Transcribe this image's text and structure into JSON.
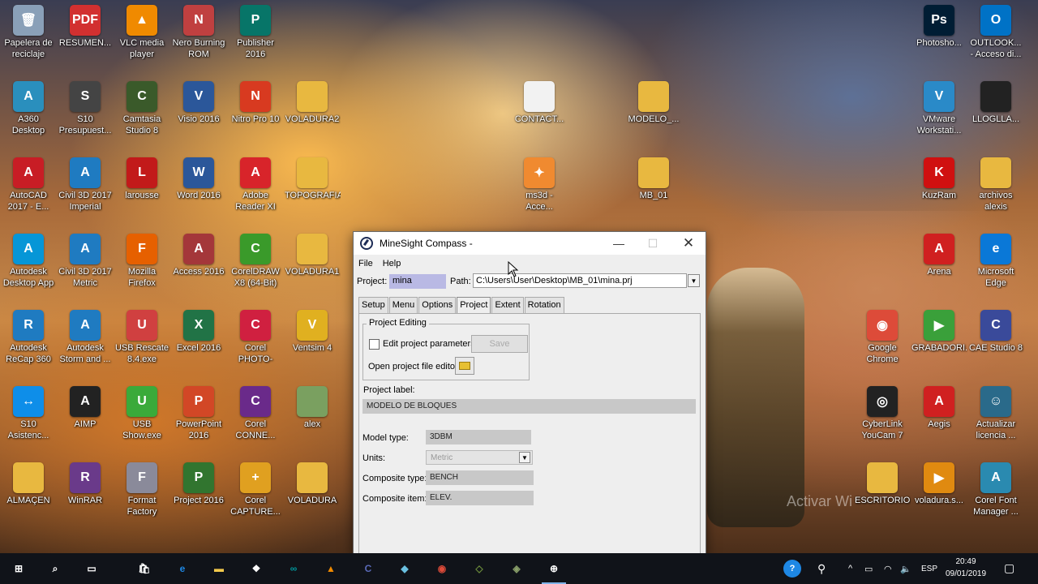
{
  "desktop": {
    "icons": [
      {
        "label": "Papelera de reciclaje",
        "icon": "recycle-bin-icon",
        "color": "#8aa0b8",
        "glyph": "🗑"
      },
      {
        "label": "RESUMEN...",
        "icon": "pdf-icon",
        "color": "#d23030",
        "glyph": "PDF"
      },
      {
        "label": "VLC media player",
        "icon": "vlc-icon",
        "color": "#f08a00",
        "glyph": "▲"
      },
      {
        "label": "Nero Burning ROM",
        "icon": "nero-icon",
        "color": "#c04040",
        "glyph": "N"
      },
      {
        "label": "Publisher 2016",
        "icon": "publisher-icon",
        "color": "#077568",
        "glyph": "P"
      },
      {
        "label": "A360 Desktop",
        "icon": "a360-icon",
        "color": "#2a8fbd",
        "glyph": "A"
      },
      {
        "label": "S10 Presupuest...",
        "icon": "s10-icon",
        "color": "#444444",
        "glyph": "S"
      },
      {
        "label": "Camtasia Studio 8",
        "icon": "camtasia-icon",
        "color": "#3a5a2a",
        "glyph": "C"
      },
      {
        "label": "Visio 2016",
        "icon": "visio-icon",
        "color": "#2b579a",
        "glyph": "V"
      },
      {
        "label": "Nitro Pro 10",
        "icon": "nitro-icon",
        "color": "#d83a20",
        "glyph": "N"
      },
      {
        "label": "VOLADURA2",
        "icon": "folder-icon",
        "color": "#e8b840",
        "glyph": ""
      },
      {
        "label": "AutoCAD 2017 - E...",
        "icon": "autocad-icon",
        "color": "#c81d25",
        "glyph": "A"
      },
      {
        "label": "Civil 3D 2017 Imperial",
        "icon": "civil3d-icon",
        "color": "#1f7bc1",
        "glyph": "A"
      },
      {
        "label": "larousse",
        "icon": "larousse-icon",
        "color": "#c21a1a",
        "glyph": "L"
      },
      {
        "label": "Word 2016",
        "icon": "word-icon",
        "color": "#2b579a",
        "glyph": "W"
      },
      {
        "label": "Adobe Reader XI",
        "icon": "acrobat-icon",
        "color": "#d8242a",
        "glyph": "A"
      },
      {
        "label": "TOPOGRAFIA",
        "icon": "folder-icon",
        "color": "#e8b840",
        "glyph": ""
      },
      {
        "label": "Autodesk Desktop App",
        "icon": "autodesk-app-icon",
        "color": "#0696d7",
        "glyph": "A"
      },
      {
        "label": "Civil 3D 2017 Metric",
        "icon": "civil3d-metric-icon",
        "color": "#1f7bc1",
        "glyph": "A"
      },
      {
        "label": "Mozilla Firefox",
        "icon": "firefox-icon",
        "color": "#e66000",
        "glyph": "F"
      },
      {
        "label": "Access 2016",
        "icon": "access-icon",
        "color": "#a4373a",
        "glyph": "A"
      },
      {
        "label": "CorelDRAW X8 (64-Bit)",
        "icon": "coreldraw-icon",
        "color": "#3a9a2a",
        "glyph": "C"
      },
      {
        "label": "VOLADURA1",
        "icon": "folder-icon",
        "color": "#e8b840",
        "glyph": ""
      },
      {
        "label": "Autodesk ReCap 360",
        "icon": "recap-icon",
        "color": "#1f7bc1",
        "glyph": "R"
      },
      {
        "label": "Autodesk Storm and ...",
        "icon": "storm-icon",
        "color": "#1f7bc1",
        "glyph": "A"
      },
      {
        "label": "USB Rescate 8.4.exe",
        "icon": "usb-rescate-icon",
        "color": "#d04040",
        "glyph": "U"
      },
      {
        "label": "Excel 2016",
        "icon": "excel-icon",
        "color": "#217346",
        "glyph": "X"
      },
      {
        "label": "Corel PHOTO-PAI...",
        "icon": "photopaint-icon",
        "color": "#d02040",
        "glyph": "C"
      },
      {
        "label": "Ventsim 4",
        "icon": "ventsim-icon",
        "color": "#e0b020",
        "glyph": "V"
      },
      {
        "label": "S10 Asistenc...",
        "icon": "teamviewer-icon",
        "color": "#0e8ee9",
        "glyph": "↔"
      },
      {
        "label": "AIMP",
        "icon": "aimp-icon",
        "color": "#222222",
        "glyph": "A"
      },
      {
        "label": "USB Show.exe",
        "icon": "usb-show-icon",
        "color": "#3aaa3a",
        "glyph": "U"
      },
      {
        "label": "PowerPoint 2016",
        "icon": "powerpoint-icon",
        "color": "#d24726",
        "glyph": "P"
      },
      {
        "label": "Corel CONNE...",
        "icon": "corel-connect-icon",
        "color": "#6a2a8a",
        "glyph": "C"
      },
      {
        "label": "alex",
        "icon": "file-icon",
        "color": "#7aa060",
        "glyph": ""
      },
      {
        "label": "ALMAÇEN",
        "icon": "folder-icon",
        "color": "#e8b840",
        "glyph": ""
      },
      {
        "label": "WinRAR",
        "icon": "winrar-icon",
        "color": "#6a3a8a",
        "glyph": "R"
      },
      {
        "label": "Format Factory",
        "icon": "format-factory-icon",
        "color": "#8a8a9a",
        "glyph": "F"
      },
      {
        "label": "Project 2016",
        "icon": "project-icon",
        "color": "#31752f",
        "glyph": "P"
      },
      {
        "label": "Corel CAPTURE...",
        "icon": "corel-capture-icon",
        "color": "#e0a020",
        "glyph": "+"
      },
      {
        "label": "VOLADURA",
        "icon": "folder-icon",
        "color": "#e8b840",
        "glyph": ""
      },
      {
        "label": "CONTACT...",
        "icon": "document-icon",
        "color": "#f2f2f2",
        "glyph": ""
      },
      {
        "label": "MODELO_...",
        "icon": "folder-icon",
        "color": "#e8b840",
        "glyph": ""
      },
      {
        "label": "ms3d - Acce...",
        "icon": "ms3d-icon",
        "color": "#f08a30",
        "glyph": "✦"
      },
      {
        "label": "MB_01",
        "icon": "folder-icon",
        "color": "#e8b840",
        "glyph": ""
      },
      {
        "label": "Photosho...",
        "icon": "photoshop-icon",
        "color": "#001d34",
        "glyph": "Ps"
      },
      {
        "label": "OUTLOOK... - Acceso di...",
        "icon": "outlook-icon",
        "color": "#0072c6",
        "glyph": "O"
      },
      {
        "label": "VMware Workstati...",
        "icon": "vmware-icon",
        "color": "#2a8ac8",
        "glyph": "V"
      },
      {
        "label": "LLOGLLA...",
        "icon": "book-icon",
        "color": "#222222",
        "glyph": ""
      },
      {
        "label": "KuzRam",
        "icon": "kuzram-icon",
        "color": "#d01010",
        "glyph": "K"
      },
      {
        "label": "archivos alexis",
        "icon": "folder-icon",
        "color": "#e8b840",
        "glyph": ""
      },
      {
        "label": "Arena",
        "icon": "arena-icon",
        "color": "#d02020",
        "glyph": "A"
      },
      {
        "label": "Microsoft Edge",
        "icon": "edge-icon",
        "color": "#0a78d7",
        "glyph": "e"
      },
      {
        "label": "Google Chrome",
        "icon": "chrome-icon",
        "color": "#dd4b39",
        "glyph": "◉"
      },
      {
        "label": "GRABADORI...",
        "icon": "grabador-icon",
        "color": "#3aa03a",
        "glyph": "▶"
      },
      {
        "label": "CAE Studio 8",
        "icon": "cae-studio-icon",
        "color": "#3a4a9a",
        "glyph": "C"
      },
      {
        "label": "CyberLink YouCam 7",
        "icon": "youcam-icon",
        "color": "#222222",
        "glyph": "◎"
      },
      {
        "label": "Aegis",
        "icon": "aegis-icon",
        "color": "#d02020",
        "glyph": "A"
      },
      {
        "label": "Actualizar licencia ...",
        "icon": "license-icon",
        "color": "#2a6a8a",
        "glyph": "☺"
      },
      {
        "label": "ESCRITORIO",
        "icon": "folder-icon",
        "color": "#e8b840",
        "glyph": ""
      },
      {
        "label": "voladura.s...",
        "icon": "slides-icon",
        "color": "#e08a10",
        "glyph": "▶"
      },
      {
        "label": "Corel Font Manager ...",
        "icon": "font-manager-icon",
        "color": "#2a8ab0",
        "glyph": "A"
      }
    ],
    "watermark": "Activar Wi"
  },
  "window": {
    "title": "MineSight Compass -",
    "menu": [
      "File",
      "Help"
    ],
    "project_label": "Project:",
    "project_value": "mina",
    "path_label": "Path:",
    "path_value": "C:\\Users\\User\\Desktop\\MB_01\\mina.prj",
    "tabs": [
      "Setup",
      "Menu",
      "Options",
      "Project",
      "Extent",
      "Rotation"
    ],
    "active_tab": "Project",
    "group_title": "Project Editing",
    "edit_params_label": "Edit project parameters",
    "save_label": "Save",
    "open_editor_label": "Open project file editor",
    "project_label_caption": "Project label:",
    "project_label_value": "MODELO DE BLOQUES",
    "model_type_label": "Model type:",
    "model_type_value": "3DBM",
    "units_label": "Units:",
    "units_value": "Metric",
    "composite_type_label": "Composite type:",
    "composite_type_value": "BENCH",
    "composite_item_label": "Composite item:",
    "composite_item_value": "ELEV."
  },
  "taskbar": {
    "items": [
      {
        "name": "start-button",
        "color": "#ffffff",
        "glyph": "⊞"
      },
      {
        "name": "search-icon",
        "color": "#ffffff",
        "glyph": "⌕"
      },
      {
        "name": "task-view-icon",
        "color": "#ffffff",
        "glyph": "▭"
      },
      {
        "name": "store-icon",
        "color": "#ffffff",
        "glyph": "🛍"
      },
      {
        "name": "edge-taskbar-icon",
        "color": "#1e88e5",
        "glyph": "e"
      },
      {
        "name": "file-explorer-icon",
        "color": "#f2c94c",
        "glyph": "▬"
      },
      {
        "name": "dropbox-icon",
        "color": "#ffffff",
        "glyph": "❖"
      },
      {
        "name": "arduino-icon",
        "color": "#00979c",
        "glyph": "∞"
      },
      {
        "name": "vlc-taskbar-icon",
        "color": "#f08a00",
        "glyph": "▲"
      },
      {
        "name": "cae-taskbar-icon",
        "color": "#5a6ab8",
        "glyph": "C"
      },
      {
        "name": "sticky-icon",
        "color": "#6ac0e0",
        "glyph": "◆"
      },
      {
        "name": "chrome-taskbar-icon",
        "color": "#dd4b39",
        "glyph": "◉"
      },
      {
        "name": "app-taskbar-icon-1",
        "color": "#6a8a3a",
        "glyph": "◇"
      },
      {
        "name": "app-taskbar-icon-2",
        "color": "#8aa06a",
        "glyph": "◈"
      },
      {
        "name": "minesight-taskbar-icon",
        "color": "#ffffff",
        "glyph": "⊕"
      }
    ],
    "tray": {
      "help": "?",
      "people": "⚲",
      "up_arrow": "^",
      "battery": "▭",
      "wifi": "◠",
      "volume": "🔈",
      "language": "ESP",
      "notifications": "▢"
    },
    "clock_time": "20:49",
    "clock_date": "09/01/2019"
  }
}
